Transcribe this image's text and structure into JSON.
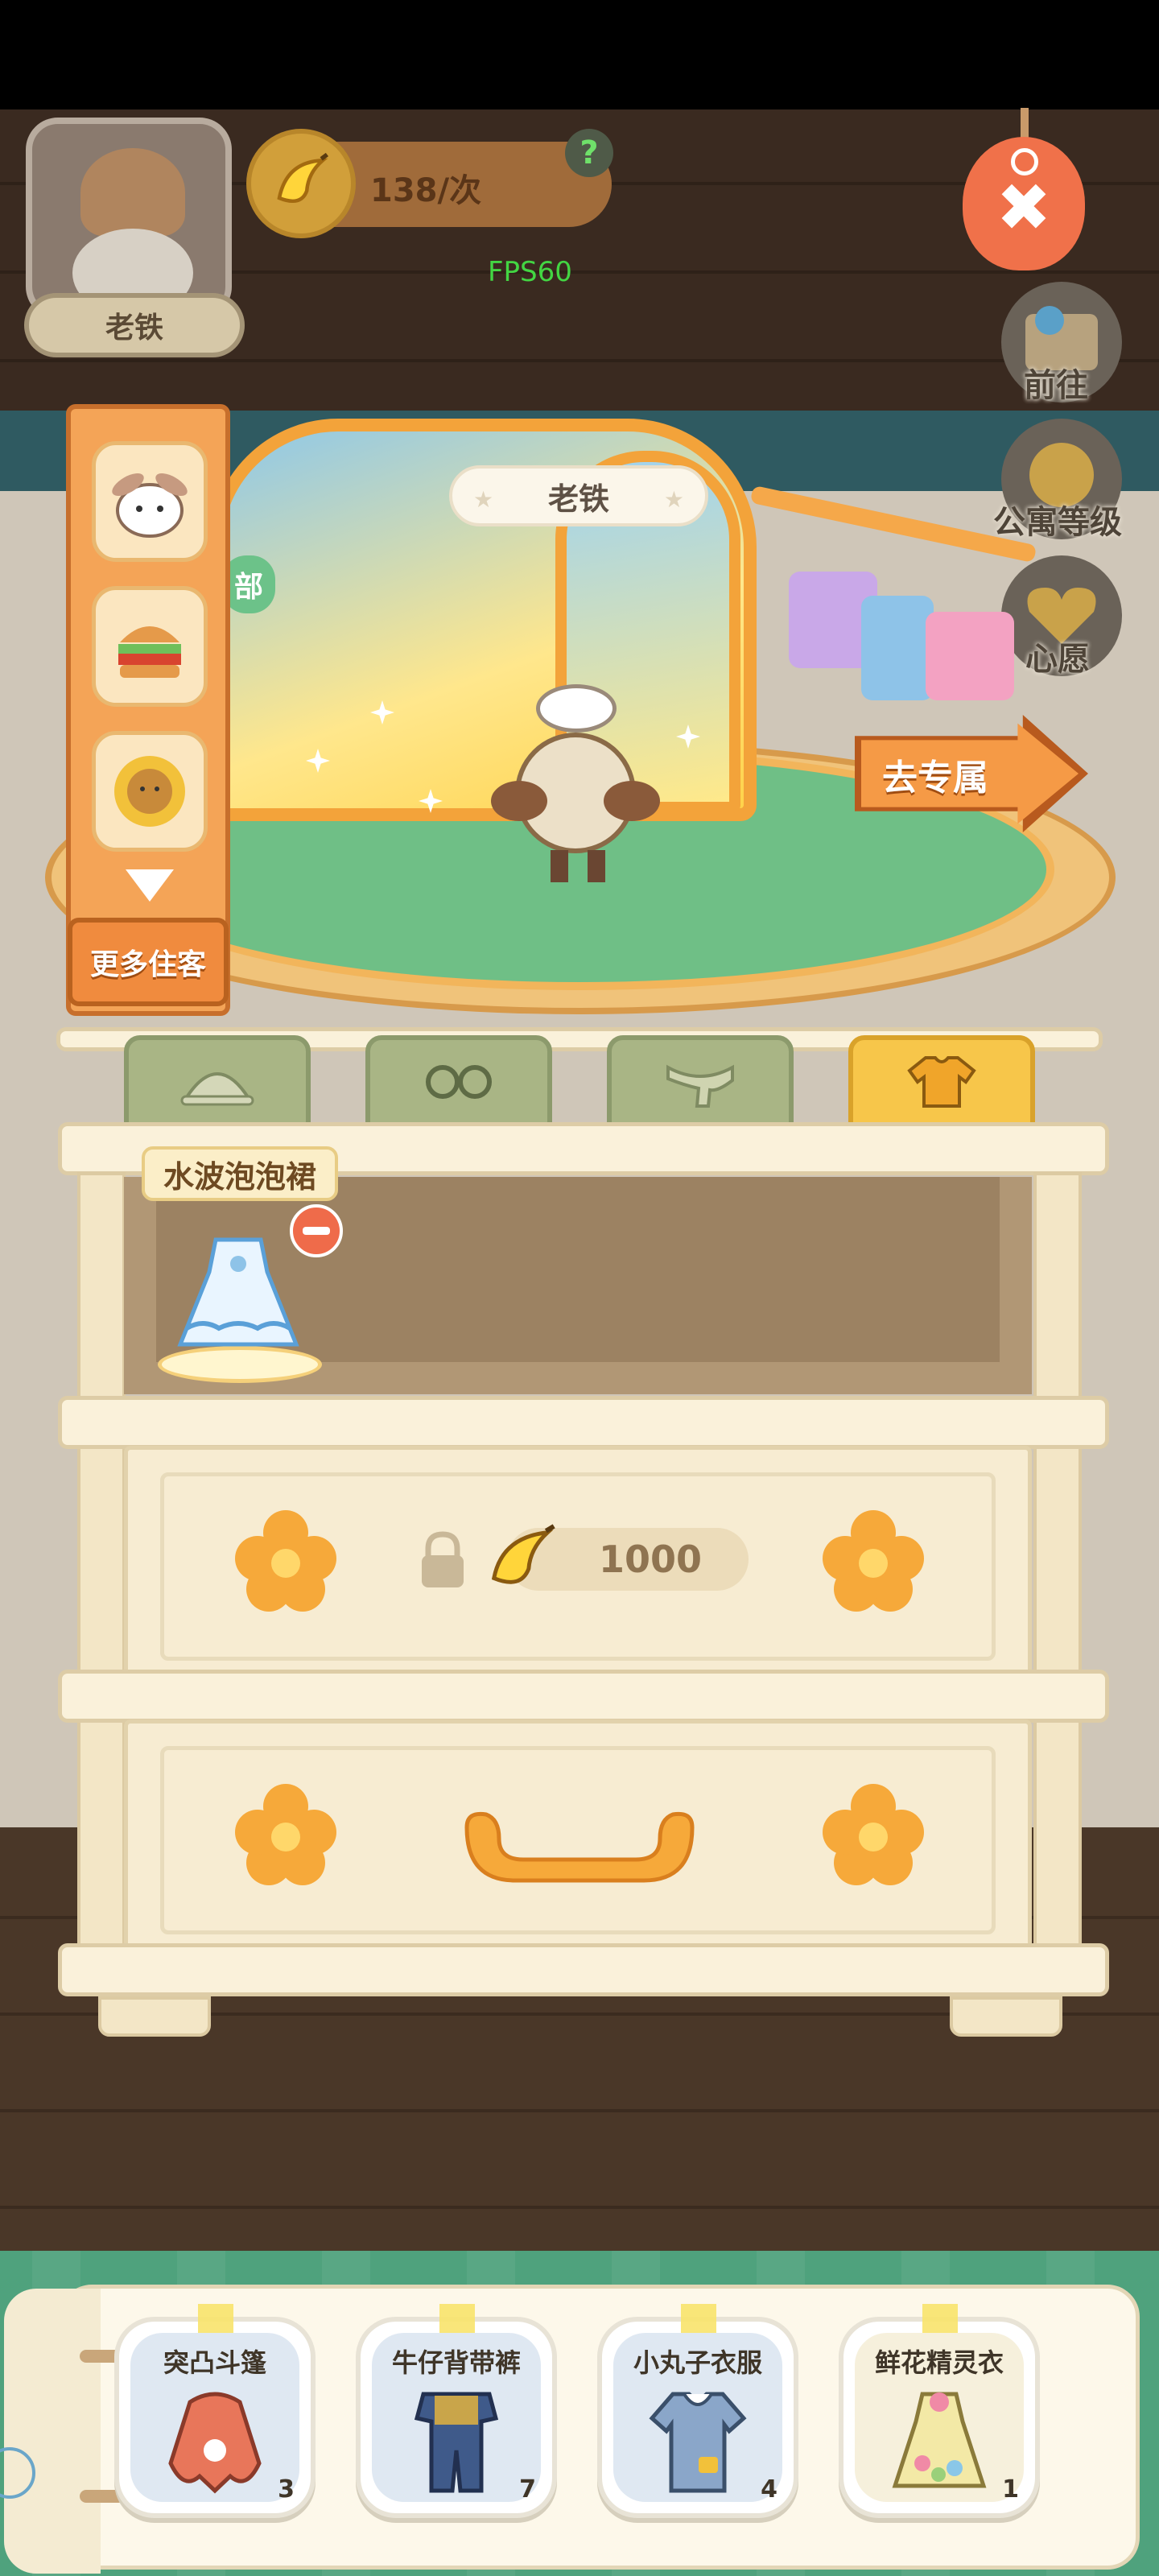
{
  "hud": {
    "avatar_name": "老铁",
    "currency_rate": "138/次",
    "help_label": "?",
    "fps": "FPS60",
    "close_label": "✖"
  },
  "side_buttons": {
    "goto": "前往",
    "apartment_level": "公寓等级",
    "wish": "心愿"
  },
  "residents": {
    "more_label": "更多住客",
    "items": [
      "rabbit-icon",
      "burger-icon",
      "sunflower-icon"
    ]
  },
  "stage": {
    "resident_name": "老铁",
    "club_tag": "部",
    "goto_exclusive": "去专属"
  },
  "tabs": [
    "hat-icon",
    "glasses-icon",
    "scarf-icon",
    "shirt-icon"
  ],
  "active_tab": "shirt-icon",
  "equipped": {
    "name": "水波泡泡裙"
  },
  "locked_slot": {
    "price": "1000"
  },
  "inventory": [
    {
      "name": "突凸斗篷",
      "count": "3"
    },
    {
      "name": "牛仔背带裤",
      "count": "7"
    },
    {
      "name": "小丸子衣服",
      "count": "4"
    },
    {
      "name": "鲜花精灵衣",
      "count": "1"
    }
  ],
  "colors": {
    "accent_orange": "#f59a46",
    "tab_active": "#f7c64a",
    "tab_inactive": "#a9b585",
    "tray_green": "#4fa27d"
  }
}
